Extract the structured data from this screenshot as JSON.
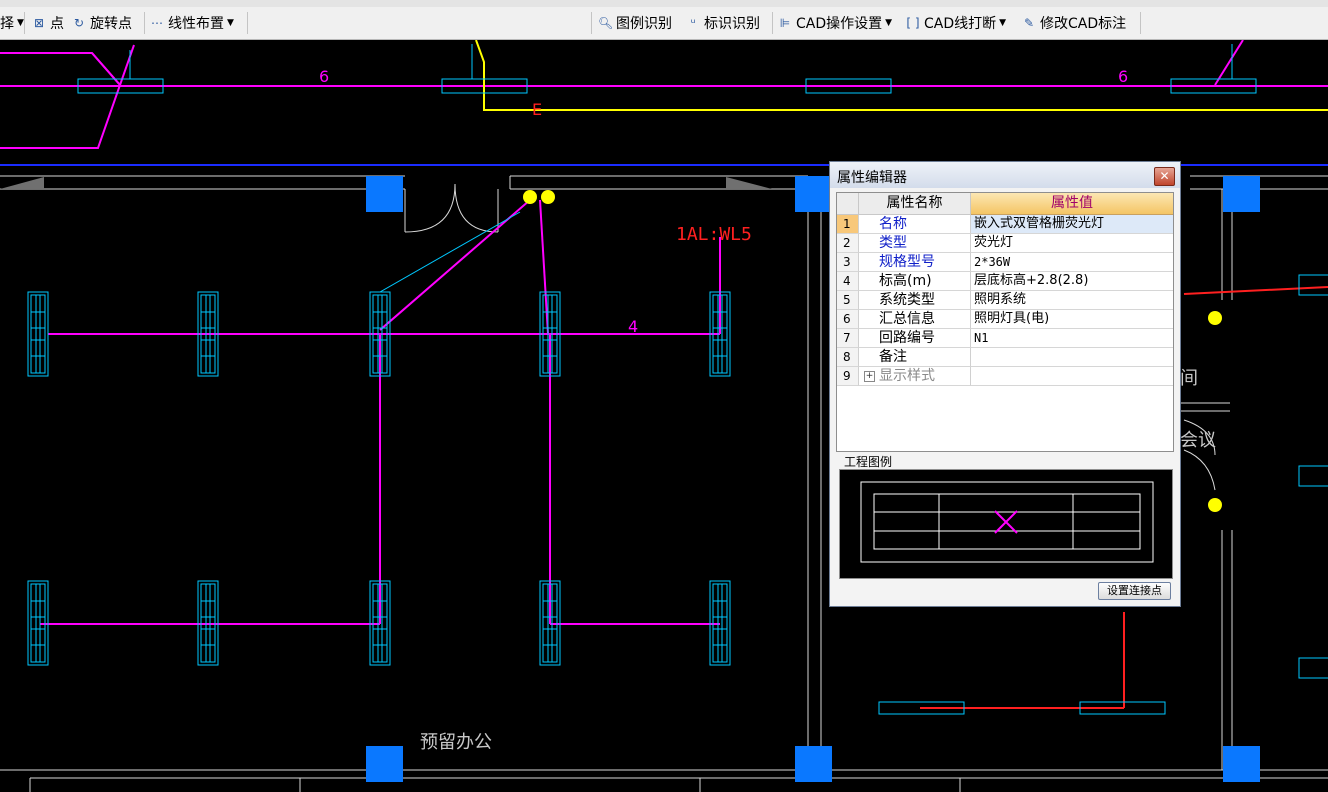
{
  "toolbar": {
    "select_label": "择",
    "point_label": "点",
    "rotate_point_label": "旋转点",
    "linear_layout_label": "线性布置",
    "legend_recognize_label": "图例识别",
    "mark_recognize_label": "标识识别",
    "cad_settings_label": "CAD操作设置",
    "cad_break_label": "CAD线打断",
    "edit_cad_annotation_label": "修改CAD标注"
  },
  "drawing": {
    "circuit_label": "1AL:WL5",
    "wire_count_marks": [
      "6",
      "6",
      "4"
    ],
    "marker_letter": "E",
    "room_label": "预留办公",
    "partial_labels": [
      "间",
      "会议"
    ]
  },
  "property_editor": {
    "title": "属性编辑器",
    "header_name": "属性名称",
    "header_value": "属性值",
    "rows": [
      {
        "num": "1",
        "name": "名称",
        "value": "嵌入式双管格栅荧光灯"
      },
      {
        "num": "2",
        "name": "类型",
        "value": "荧光灯"
      },
      {
        "num": "3",
        "name": "规格型号",
        "value": "2*36W"
      },
      {
        "num": "4",
        "name": "标高(m)",
        "value": "层底标高+2.8(2.8)"
      },
      {
        "num": "5",
        "name": "系统类型",
        "value": "照明系统"
      },
      {
        "num": "6",
        "name": "汇总信息",
        "value": "照明灯具(电)"
      },
      {
        "num": "7",
        "name": "回路编号",
        "value": "N1"
      },
      {
        "num": "8",
        "name": "备注",
        "value": ""
      },
      {
        "num": "9",
        "name": "显示样式",
        "value": ""
      }
    ],
    "legend_label": "工程图例",
    "set_connection_button": "设置连接点"
  },
  "colors": {
    "wire": "#ff00ff",
    "fixture": "#00c8ff",
    "column": "#0a78ff",
    "wall": "#d8d8d8",
    "text_red": "#ff2020",
    "highlight": "#ffff00"
  }
}
